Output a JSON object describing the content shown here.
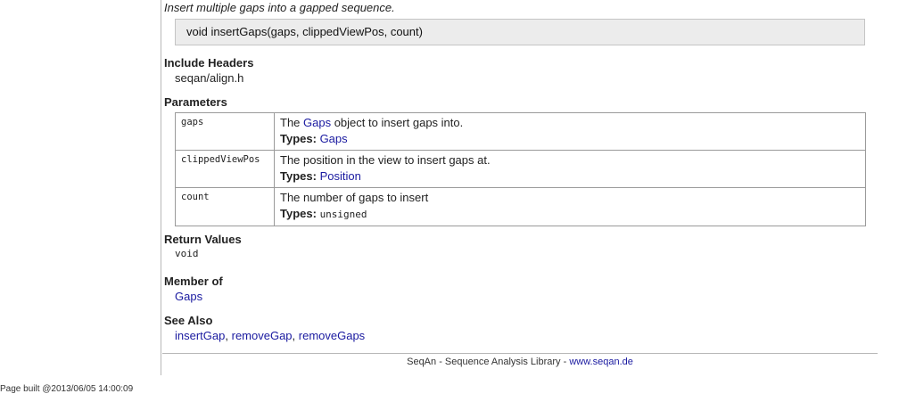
{
  "summary": "Insert multiple gaps into a gapped sequence.",
  "signature": "void insertGaps(gaps, clippedViewPos, count)",
  "include_headers": {
    "heading": "Include Headers",
    "value": "seqan/align.h"
  },
  "parameters": {
    "heading": "Parameters",
    "types_label": "Types:",
    "rows": [
      {
        "name": "gaps",
        "desc_before": "The ",
        "desc_link": "Gaps",
        "desc_after": " object to insert gaps into.",
        "type": "Gaps"
      },
      {
        "name": "clippedViewPos",
        "desc": "The position in the view to insert gaps at.",
        "type": "Position"
      },
      {
        "name": "count",
        "desc": "The number of gaps to insert",
        "type": "unsigned"
      }
    ]
  },
  "return_values": {
    "heading": "Return Values",
    "value": "void"
  },
  "member_of": {
    "heading": "Member of",
    "value": "Gaps"
  },
  "see_also": {
    "heading": "See Also",
    "links": [
      "insertGap",
      "removeGap",
      "removeGaps"
    ],
    "separator": ", "
  },
  "footer": {
    "text": "SeqAn - Sequence Analysis Library - ",
    "link": "www.seqan.de"
  },
  "page_built": "Page built @2013/06/05 14:00:09",
  "colors": {
    "link": "#1a1aa0",
    "signature_bg": "#ececec",
    "border": "#9a9a9a"
  }
}
